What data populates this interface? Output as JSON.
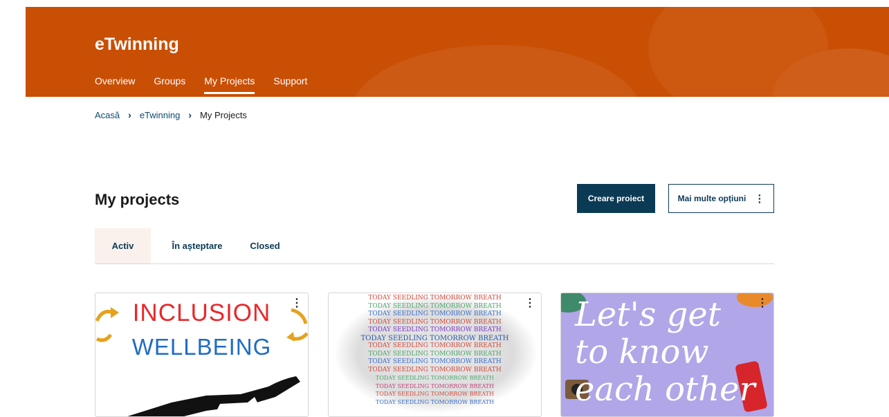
{
  "header": {
    "brand": "eTwinning",
    "nav": [
      {
        "label": "Overview",
        "active": false
      },
      {
        "label": "Groups",
        "active": false
      },
      {
        "label": "My Projects",
        "active": true
      },
      {
        "label": "Support",
        "active": false
      }
    ],
    "accent_color": "#c94f05"
  },
  "breadcrumb": {
    "items": [
      "Acasă",
      "eTwinning"
    ],
    "current": "My Projects"
  },
  "main": {
    "title": "My projects",
    "create_button": "Creare proiect",
    "more_options_button": "Mai multe opțiuni",
    "more_options_icon": "kebab-vertical-icon",
    "tabs": [
      {
        "label": "Activ",
        "active": true
      },
      {
        "label": "În așteptare",
        "active": false
      },
      {
        "label": "Closed",
        "active": false
      }
    ]
  },
  "cards": [
    {
      "image_text_line1": "INCLUSION",
      "image_text_line2": "WELLBEING",
      "menu_icon": "kebab-vertical-icon"
    },
    {
      "image_text": "TODAY SEEDLING TOMORROW BREATH",
      "menu_icon": "kebab-vertical-icon"
    },
    {
      "image_text_line1": "Let's get",
      "image_text_line2": "to know",
      "image_text_line3": "each other",
      "menu_icon": "kebab-vertical-icon"
    }
  ],
  "colors": {
    "primary_dark": "#0b3a55",
    "hero_orange": "#c94f05",
    "tab_active_bg": "#faf1ec"
  }
}
